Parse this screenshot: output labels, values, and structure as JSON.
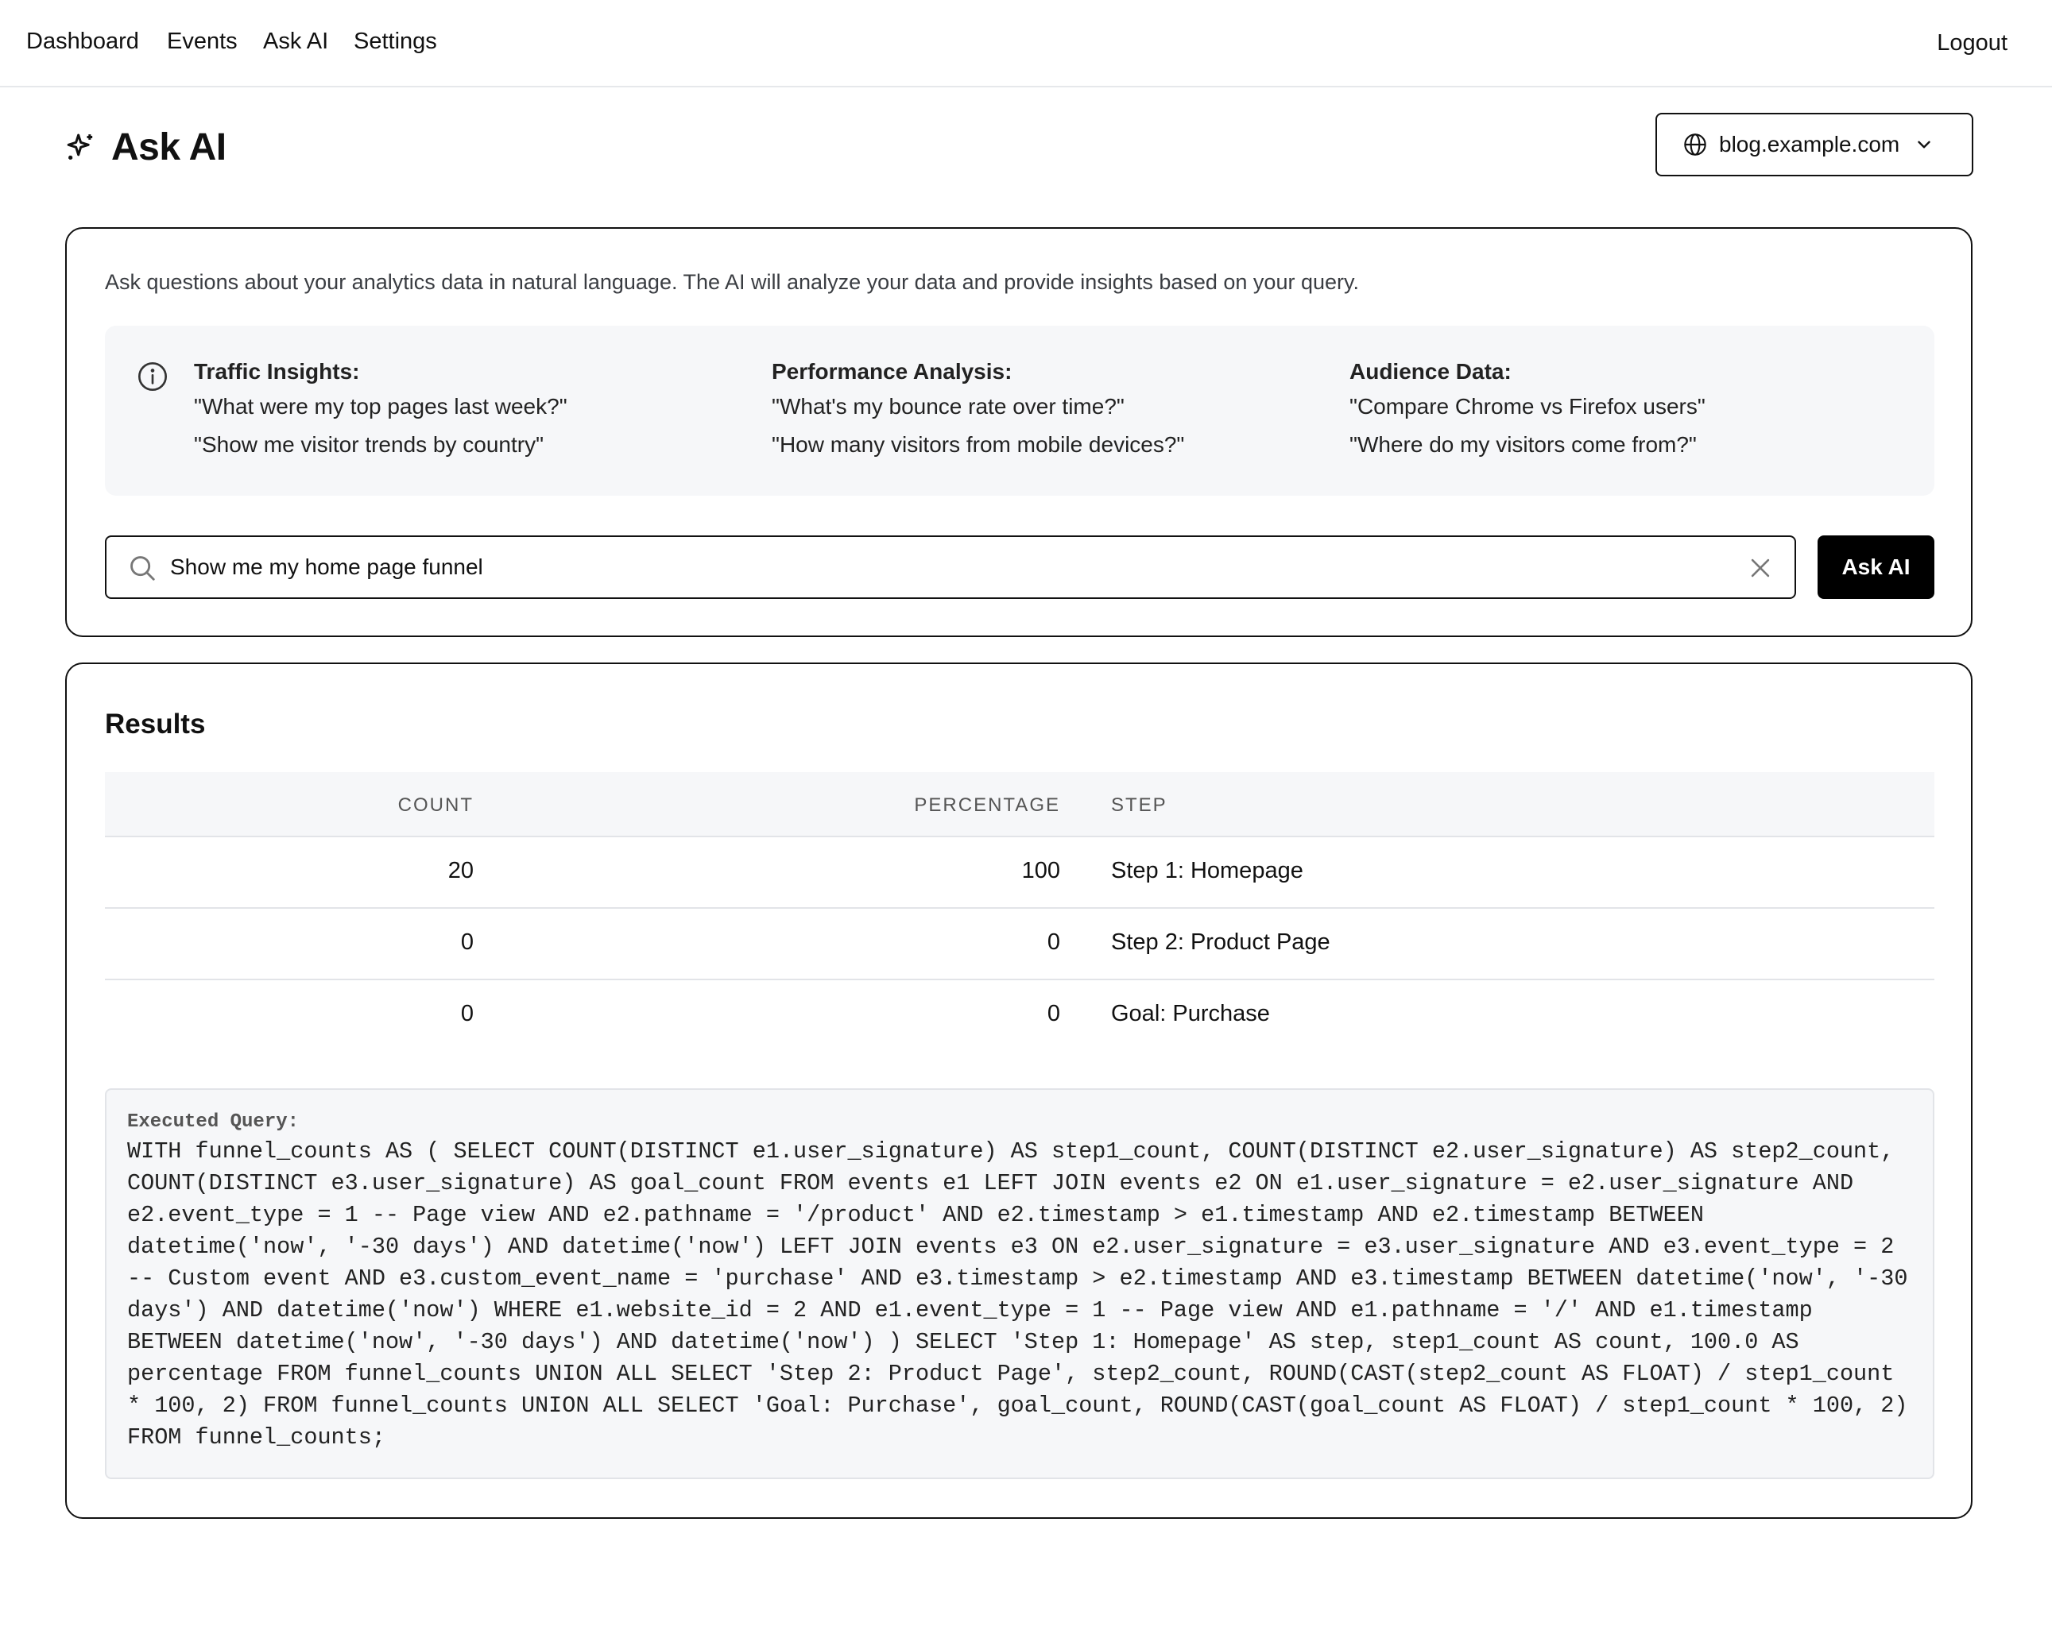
{
  "nav": {
    "items": [
      "Dashboard",
      "Events",
      "Ask AI",
      "Settings"
    ],
    "logout": "Logout"
  },
  "header": {
    "title": "Ask AI",
    "icon": "sparkles-icon"
  },
  "site_selector": {
    "value": "blog.example.com",
    "icon": "globe-icon"
  },
  "ask": {
    "description": "Ask questions about your analytics data in natural language. The AI will analyze your data and provide insights based on your query.",
    "examples": [
      {
        "title": "Traffic Insights:",
        "items": [
          "\"What were my top pages last week?\"",
          "\"Show me visitor trends by country\""
        ]
      },
      {
        "title": "Performance Analysis:",
        "items": [
          "\"What's my bounce rate over time?\"",
          "\"How many visitors from mobile devices?\""
        ]
      },
      {
        "title": "Audience Data:",
        "items": [
          "\"Compare Chrome vs Firefox users\"",
          "\"Where do my visitors come from?\""
        ]
      }
    ],
    "query_value": "Show me my home page funnel",
    "button_label": "Ask AI"
  },
  "results": {
    "title": "Results",
    "columns": [
      "COUNT",
      "PERCENTAGE",
      "STEP"
    ],
    "rows": [
      {
        "count": "20",
        "percentage": "100",
        "step": "Step 1: Homepage"
      },
      {
        "count": "0",
        "percentage": "0",
        "step": "Step 2: Product Page"
      },
      {
        "count": "0",
        "percentage": "0",
        "step": "Goal: Purchase"
      }
    ],
    "query_label": "Executed Query:",
    "query_text": "WITH funnel_counts AS ( SELECT COUNT(DISTINCT e1.user_signature) AS step1_count, COUNT(DISTINCT e2.user_signature) AS step2_count, COUNT(DISTINCT e3.user_signature) AS goal_count FROM events e1 LEFT JOIN events e2 ON e1.user_signature = e2.user_signature AND e2.event_type = 1 -- Page view AND e2.pathname = '/product' AND e2.timestamp > e1.timestamp AND e2.timestamp BETWEEN datetime('now', '-30 days') AND datetime('now') LEFT JOIN events e3 ON e2.user_signature = e3.user_signature AND e3.event_type = 2 -- Custom event AND e3.custom_event_name = 'purchase' AND e3.timestamp > e2.timestamp AND e3.timestamp BETWEEN datetime('now', '-30 days') AND datetime('now') WHERE e1.website_id = 2 AND e1.event_type = 1 -- Page view AND e1.pathname = '/' AND e1.timestamp BETWEEN datetime('now', '-30 days') AND datetime('now') ) SELECT 'Step 1: Homepage' AS step, step1_count AS count, 100.0 AS percentage FROM funnel_counts UNION ALL SELECT 'Step 2: Product Page', step2_count, ROUND(CAST(step2_count AS FLOAT) / step1_count * 100, 2) FROM funnel_counts UNION ALL SELECT 'Goal: Purchase', goal_count, ROUND(CAST(goal_count AS FLOAT) / step1_count * 100, 2) FROM funnel_counts;"
  }
}
